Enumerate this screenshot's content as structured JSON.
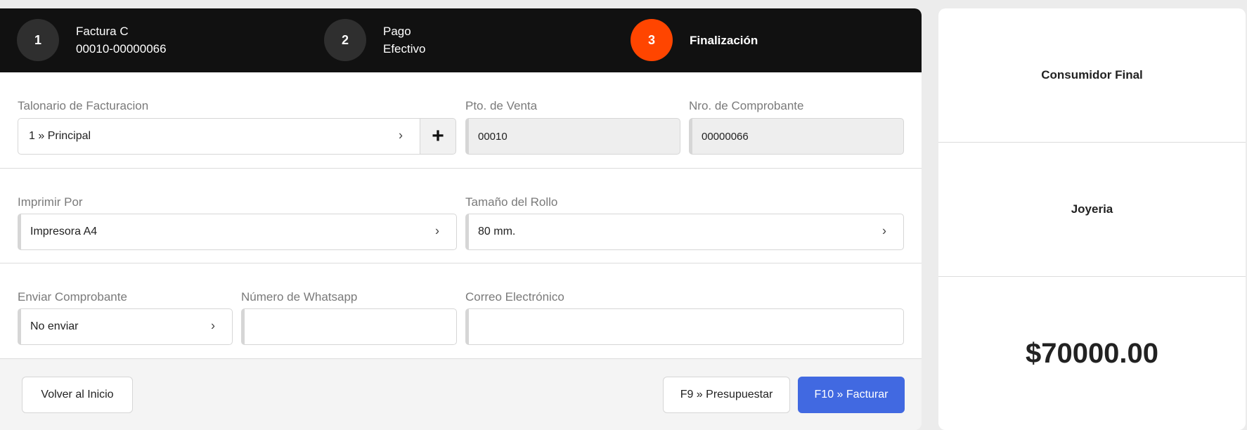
{
  "steps": [
    {
      "number": "1",
      "title": "Factura C",
      "subtitle": "00010-00000066"
    },
    {
      "number": "2",
      "title": "Pago",
      "subtitle": "Efectivo"
    },
    {
      "number": "3",
      "title": "Finalización"
    }
  ],
  "accent_color": "#ff4500",
  "primary_color": "#4169e1",
  "form": {
    "talonario": {
      "label": "Talonario de Facturacion",
      "value": "1 » Principal",
      "add_label": "+"
    },
    "pto_venta": {
      "label": "Pto. de Venta",
      "value": "00010"
    },
    "nro_comprobante": {
      "label": "Nro. de Comprobante",
      "value": "00000066"
    },
    "imprimir_por": {
      "label": "Imprimir Por",
      "value": "Impresora A4"
    },
    "tamano_rollo": {
      "label": "Tamaño del Rollo",
      "value": "80 mm."
    },
    "enviar": {
      "label": "Enviar Comprobante",
      "value": "No enviar"
    },
    "whatsapp": {
      "label": "Número de Whatsapp",
      "value": ""
    },
    "correo": {
      "label": "Correo Electrónico",
      "value": ""
    }
  },
  "footer": {
    "back_label": "Volver al Inicio",
    "presupuestar_label": "F9 » Presupuestar",
    "facturar_label": "F10 » Facturar"
  },
  "summary": {
    "customer": "Consumidor Final",
    "category": "Joyeria",
    "total": "$70000.00"
  }
}
